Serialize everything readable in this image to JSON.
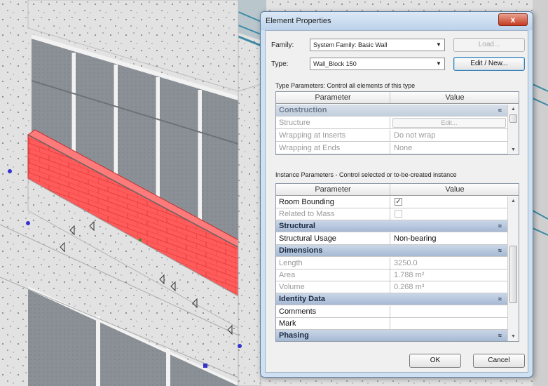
{
  "dialog": {
    "title": "Element Properties",
    "close_glyph": "x",
    "family_label": "Family:",
    "family_value": "System Family: Basic Wall",
    "type_label": "Type:",
    "type_value": "Wall_Block 150",
    "load_button": "Load...",
    "edit_new_button": "Edit / New...",
    "ok_button": "OK",
    "cancel_button": "Cancel"
  },
  "type_parameters": {
    "caption": "Type Parameters: Control all elements of this type",
    "header": {
      "parameter": "Parameter",
      "value": "Value"
    },
    "group": "Construction",
    "rows": [
      {
        "parameter": "Structure",
        "value": "Edit..."
      },
      {
        "parameter": "Wrapping at Inserts",
        "value": "Do not wrap"
      },
      {
        "parameter": "Wrapping at Ends",
        "value": "None"
      }
    ]
  },
  "instance_parameters": {
    "caption": "Instance Parameters - Control selected or to-be-created instance",
    "header": {
      "parameter": "Parameter",
      "value": "Value"
    },
    "rows": [
      {
        "parameter": "Room Bounding",
        "value": "✓"
      },
      {
        "parameter": "Related to Mass",
        "value": ""
      }
    ],
    "groups": {
      "structural": {
        "label": "Structural",
        "rows": [
          {
            "parameter": "Structural Usage",
            "value": "Non-bearing"
          }
        ]
      },
      "dimensions": {
        "label": "Dimensions",
        "rows": [
          {
            "parameter": "Length",
            "value": "3250.0"
          },
          {
            "parameter": "Area",
            "value": "1.788 m²"
          },
          {
            "parameter": "Volume",
            "value": "0.268 m³"
          }
        ]
      },
      "identity": {
        "label": "Identity Data",
        "rows": [
          {
            "parameter": "Comments",
            "value": ""
          },
          {
            "parameter": "Mark",
            "value": ""
          }
        ]
      },
      "phasing": {
        "label": "Phasing"
      }
    }
  },
  "icons": {
    "collapse": "collapse-chevron-icon",
    "dropdown": "dropdown-arrow-icon",
    "close": "close-icon"
  },
  "colors": {
    "selected_wall": "#ff5b5b",
    "group_header": "#a6b9d3",
    "dialog_frame": "#cfe0f2"
  }
}
